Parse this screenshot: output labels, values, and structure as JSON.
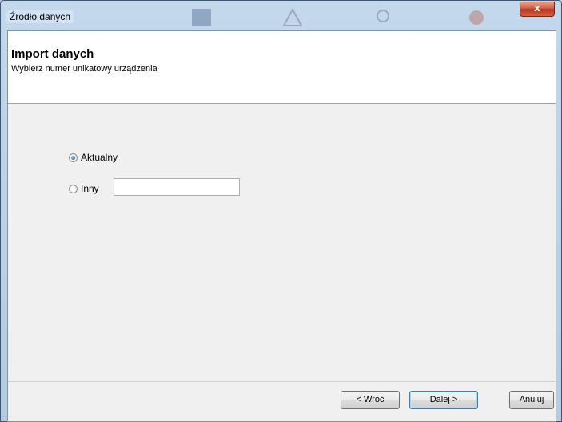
{
  "window": {
    "title": "Źródło danych",
    "close_label": "x"
  },
  "header": {
    "title": "Import danych",
    "subtitle": "Wybierz numer unikatowy urządzenia"
  },
  "options": {
    "current_label": "Aktualny",
    "current_selected": true,
    "other_label": "Inny",
    "other_selected": false,
    "other_value": ""
  },
  "buttons": {
    "back_label": "< Wróć",
    "next_label": "Dalej >",
    "cancel_label": "Anuluj"
  },
  "colors": {
    "title_bar": "#b3cbe3",
    "close_button": "#c8452c",
    "default_button_border": "#3c7fb1"
  }
}
